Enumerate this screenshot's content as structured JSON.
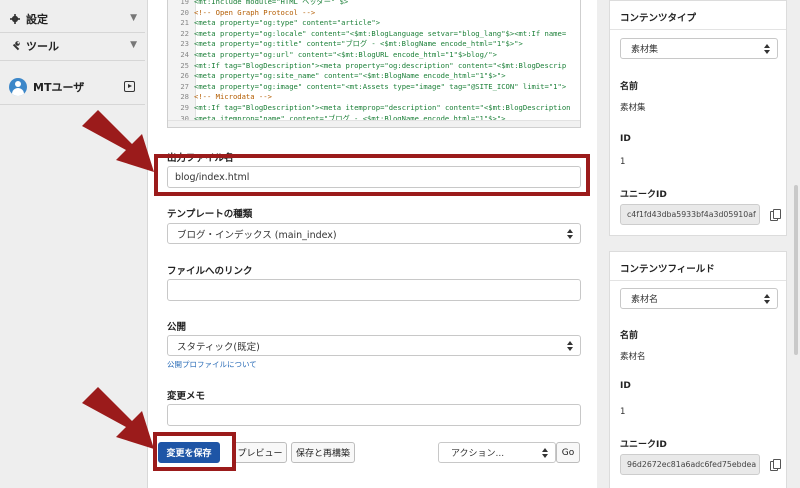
{
  "sidebar": {
    "items": [
      {
        "label": "設定"
      },
      {
        "label": "ツール"
      }
    ],
    "user": {
      "name": "MTユーザ"
    }
  },
  "code": {
    "lines": [
      {
        "no": "19",
        "text": "<mt:Include module=\"HTML ヘッダー\" $>",
        "kind": "tag"
      },
      {
        "no": "20",
        "text": "<!-- Open Graph Protocol -->",
        "kind": "comment"
      },
      {
        "no": "21",
        "text": "<meta property=\"og:type\" content=\"article\">",
        "kind": "tag"
      },
      {
        "no": "22",
        "text": "<meta property=\"og:locale\" content=\"<$mt:BlogLanguage setvar=\"blog_lang\"$><mt:If name=",
        "kind": "tag"
      },
      {
        "no": "23",
        "text": "<meta property=\"og:title\" content=\"ブログ - <$mt:BlogName encode_html=\"1\"$>\">",
        "kind": "tag"
      },
      {
        "no": "24",
        "text": "<meta property=\"og:url\" content=\"<$mt:BlogURL encode_html=\"1\"$>blog/\">",
        "kind": "tag"
      },
      {
        "no": "25",
        "text": "<mt:If tag=\"BlogDescription\"><meta property=\"og:description\" content=\"<$mt:BlogDescrip",
        "kind": "tag"
      },
      {
        "no": "26",
        "text": "<meta property=\"og:site_name\" content=\"<$mt:BlogName encode_html=\"1\"$>\">",
        "kind": "tag"
      },
      {
        "no": "27",
        "text": "<meta property=\"og:image\" content=\"<mt:Assets type=\"image\" tag=\"@SITE_ICON\" limit=\"1\">",
        "kind": "tag"
      },
      {
        "no": "28",
        "text": "<!-- Microdata -->",
        "kind": "comment"
      },
      {
        "no": "29",
        "text": "<mt:If tag=\"BlogDescription\"><meta itemprop=\"description\" content=\"<$mt:BlogDescription",
        "kind": "tag"
      },
      {
        "no": "30",
        "text": "<meta itemprop=\"name\" content=\"ブログ - <$mt:BlogName encode_html=\"1\"$>\">",
        "kind": "tag"
      }
    ]
  },
  "form": {
    "output_file": {
      "label": "出力ファイル名",
      "value": "blog/index.html"
    },
    "template_type": {
      "label": "テンプレートの種類",
      "value": "ブログ・インデックス (main_index)"
    },
    "file_link": {
      "label": "ファイルへのリンク",
      "value": ""
    },
    "publish": {
      "label": "公開",
      "value": "スタティック(既定)",
      "help_link": "公開プロファイルについて"
    },
    "change_memo": {
      "label": "変更メモ",
      "value": ""
    }
  },
  "actions": {
    "save_label": "変更を保存",
    "preview_label": "プレビュー",
    "save_rebuild_label": "保存と再構築",
    "action_select": "アクション...",
    "go_label": "Go"
  },
  "panel": {
    "content_type": {
      "title": "コンテンツタイプ",
      "select_value": "素材集",
      "name_label": "名前",
      "name_value": "素材集",
      "id_label": "ID",
      "id_value": "1",
      "uid_label": "ユニークID",
      "uid_value": "c4f1fd43dba5933bf4a3d05910af"
    },
    "content_field": {
      "title": "コンテンツフィールド",
      "select_value": "素材名",
      "name_label": "名前",
      "name_value": "素材名",
      "id_label": "ID",
      "id_value": "1",
      "uid_label": "ユニークID",
      "uid_value": "96d2672ec81a6adc6fed75ebdea"
    }
  },
  "colors": {
    "annotation_red": "#9b1b1b",
    "primary_blue": "#1e55a6",
    "link_blue": "#2a6cb7"
  },
  "icons": {
    "settings": "gear-icon",
    "tools": "wrench-icon",
    "annotation": "red-arrow-icon"
  }
}
